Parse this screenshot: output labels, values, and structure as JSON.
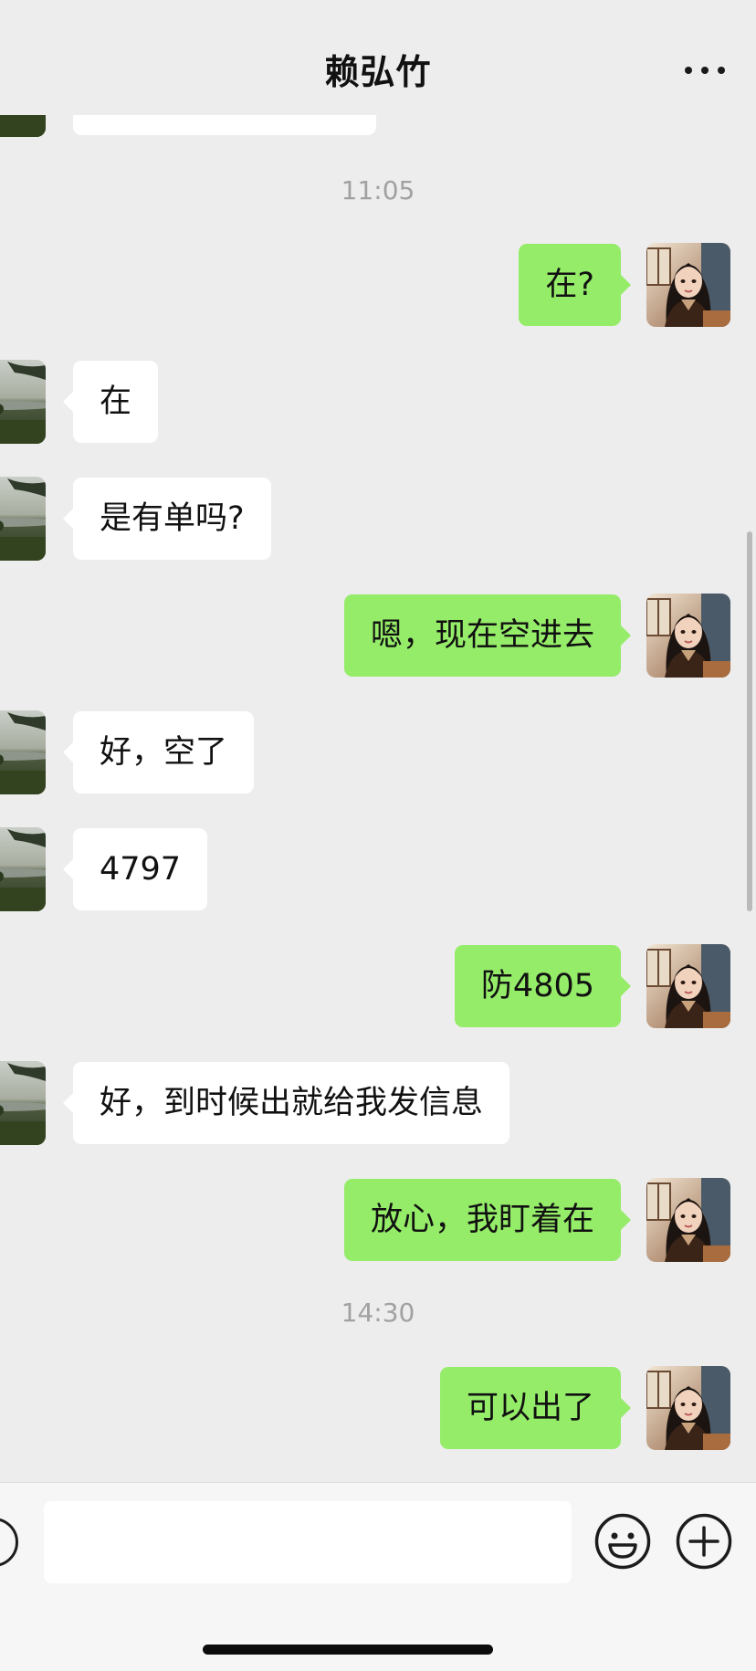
{
  "header": {
    "title": "赖弘竹",
    "more_icon": "more-dots-icon"
  },
  "timestamps": [
    "11:05",
    "14:30"
  ],
  "messages": [
    {
      "side": "out",
      "text": "在?"
    },
    {
      "side": "in",
      "text": "在"
    },
    {
      "side": "in",
      "text": "是有单吗?"
    },
    {
      "side": "out",
      "text": "嗯，现在空进去"
    },
    {
      "side": "in",
      "text": "好，空了"
    },
    {
      "side": "in",
      "text": "4797"
    },
    {
      "side": "out",
      "text": "防4805"
    },
    {
      "side": "in",
      "text": "好，到时候出就给我发信息"
    },
    {
      "side": "out",
      "text": "放心，我盯着在"
    },
    {
      "side": "out",
      "text": "可以出了"
    }
  ],
  "input": {
    "value": "",
    "voice_icon": "voice-icon",
    "emoji_icon": "emoji-icon",
    "plus_icon": "plus-icon"
  },
  "colors": {
    "background": "#ededed",
    "outgoing_bubble": "#95ec69",
    "incoming_bubble": "#ffffff",
    "timestamp": "#a1a1a1"
  }
}
